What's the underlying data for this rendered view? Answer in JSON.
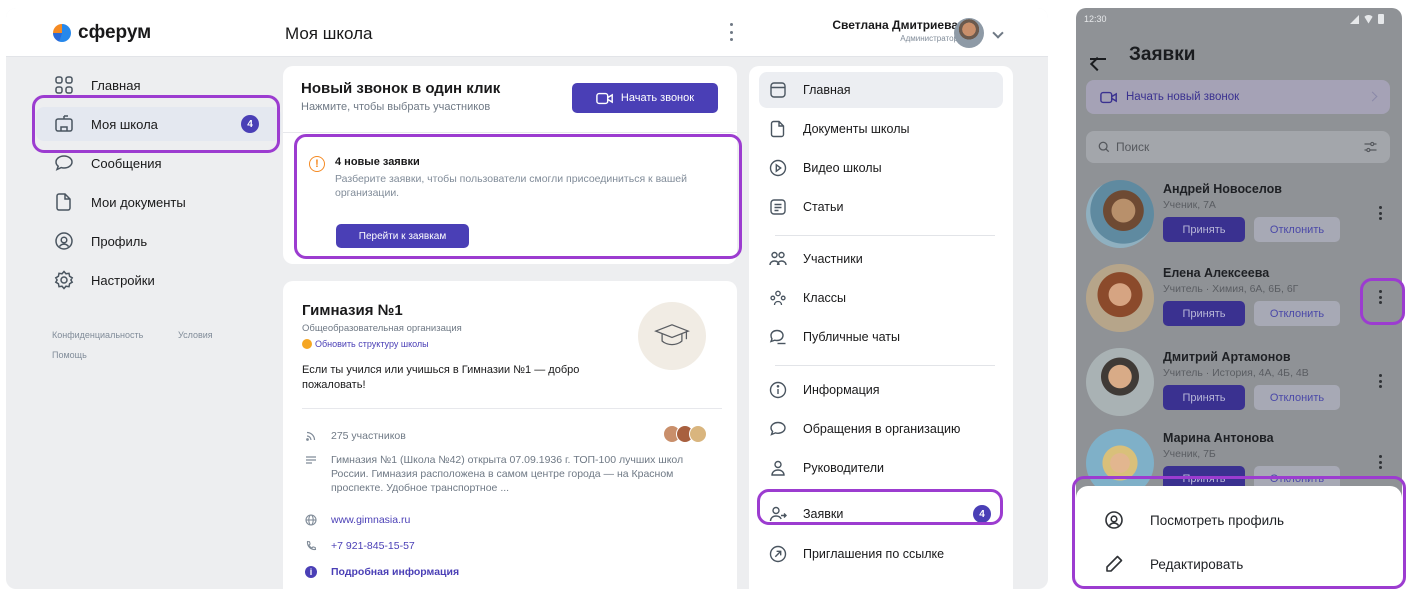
{
  "app": {
    "logo_text": "сферум",
    "page_title": "Моя школа",
    "user": {
      "name": "Светлана Дмитриева",
      "role": "Администратор"
    }
  },
  "sidebar": {
    "items": [
      {
        "label": "Главная",
        "icon": "grid-icon"
      },
      {
        "label": "Моя школа",
        "icon": "school-icon",
        "badge": "4"
      },
      {
        "label": "Сообщения",
        "icon": "chat-icon"
      },
      {
        "label": "Мои документы",
        "icon": "document-icon"
      },
      {
        "label": "Профиль",
        "icon": "profile-icon"
      },
      {
        "label": "Настройки",
        "icon": "gear-icon"
      }
    ],
    "footer": {
      "privacy": "Конфиденциальность",
      "terms": "Условия",
      "help": "Помощь"
    }
  },
  "call_card": {
    "title": "Новый звонок в один клик",
    "subtitle": "Нажмите, чтобы выбрать участников",
    "button": "Начать звонок"
  },
  "requests_card": {
    "title": "4 новые заявки",
    "text": "Разберите заявки, чтобы пользователи смогли присоединиться к вашей организации.",
    "button": "Перейти к заявкам"
  },
  "school_card": {
    "name": "Гимназия №1",
    "type": "Общеобразовательная организация",
    "update_link": "Обновить структуру школы",
    "welcome": "Если ты учился или учишься в Гимназии №1 — добро пожаловать!",
    "members": "275 участников",
    "description": "Гимназия №1 (Школа №42) открыта 07.09.1936 г. ТОП-100 лучших школ России. Гимназия расположена в самом центре города — на Красном проспекте. Удобное транспортное ...",
    "website": "www.gimnasia.ru",
    "phone": "+7 921-845-15-57",
    "more_info": "Подробная информация"
  },
  "right_nav": {
    "items": [
      {
        "label": "Главная",
        "icon": "window-icon"
      },
      {
        "label": "Документы школы",
        "icon": "document-icon"
      },
      {
        "label": "Видео школы",
        "icon": "play-icon"
      },
      {
        "label": "Статьи",
        "icon": "article-icon"
      },
      {
        "label": "Участники",
        "icon": "users-icon"
      },
      {
        "label": "Классы",
        "icon": "class-icon"
      },
      {
        "label": "Публичные чаты",
        "icon": "public-chat-icon"
      },
      {
        "label": "Информация",
        "icon": "info-icon"
      },
      {
        "label": "Обращения в организацию",
        "icon": "chat-icon"
      },
      {
        "label": "Руководители",
        "icon": "user-icon"
      },
      {
        "label": "Заявки",
        "icon": "user-add-icon",
        "badge": "4"
      },
      {
        "label": "Приглашения по ссылке",
        "icon": "link-arrow-icon"
      }
    ]
  },
  "phone": {
    "time": "12:30",
    "title": "Заявки",
    "call_button": "Начать новый звонок",
    "search_placeholder": "Поиск",
    "accept_label": "Принять",
    "reject_label": "Отклонить",
    "requests": [
      {
        "name": "Андрей Новоселов",
        "role": "Ученик, 7А"
      },
      {
        "name": "Елена Алексеева",
        "role": "Учитель · Химия, 6А, 6Б, 6Г"
      },
      {
        "name": "Дмитрий Артамонов",
        "role": "Учитель · История, 4А, 4Б, 4В"
      },
      {
        "name": "Марина Антонова",
        "role": "Ученик, 7Б"
      }
    ],
    "sheet": [
      {
        "label": "Посмотреть профиль",
        "icon": "profile-icon"
      },
      {
        "label": "Редактировать",
        "icon": "pencil-icon"
      }
    ]
  },
  "colors": {
    "accent": "#4a3fb6",
    "highlight": "#9c3cd0",
    "warning": "#f58a23"
  }
}
